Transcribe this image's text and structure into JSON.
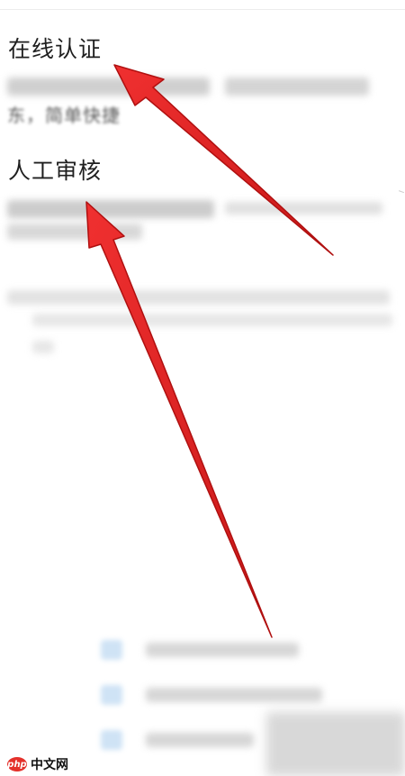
{
  "sections": [
    {
      "title": "在线认证",
      "description_partial": "东，简单快捷"
    },
    {
      "title": "人工审核"
    }
  ],
  "watermark": {
    "logo": "php",
    "text": "中文网"
  },
  "colors": {
    "arrow": "#e41e1e",
    "arrow_dark": "#b81414",
    "checkbox": "#cfe3f5"
  },
  "icons": [
    "checkbox-icon",
    "checkbox-icon",
    "checkbox-icon"
  ]
}
